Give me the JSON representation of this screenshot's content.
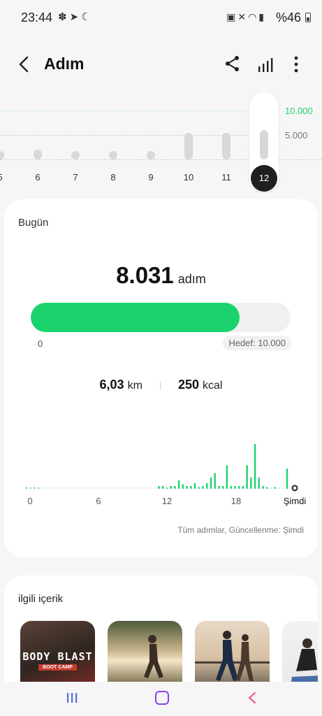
{
  "status_bar": {
    "time": "23:44",
    "battery": "%46",
    "left_icons": [
      "notification-icon",
      "telegram-icon",
      "moon-icon"
    ],
    "right_icons": [
      "sim-icon",
      "mute-icon",
      "wifi-icon",
      "signal-icon"
    ]
  },
  "header": {
    "title": "Adım",
    "icons": [
      "back-icon",
      "share-icon",
      "bar-chart-icon",
      "more-icon"
    ]
  },
  "week_chart": {
    "goal_label": "10.000",
    "mid_label": "5.000",
    "days": [
      "5",
      "6",
      "7",
      "8",
      "9",
      "10",
      "11",
      "12"
    ],
    "levels": [
      0.05,
      0.2,
      0.04,
      0.04,
      0.04,
      0.55,
      0.55,
      0.6
    ],
    "selected_day": "12"
  },
  "today": {
    "label": "Bugün",
    "steps": "8.031",
    "steps_unit": "adım",
    "progress_fraction": 0.8031,
    "progress_start": "0",
    "goal_text": "Hedef: 10.000",
    "distance_value": "6,03",
    "distance_unit": "km",
    "calories_value": "250",
    "calories_unit": "kcal",
    "hourly_axis": [
      "0",
      "6",
      "12",
      "18",
      "Şimdi"
    ],
    "hourly_levels": [
      0,
      0,
      0,
      0,
      0,
      0,
      0,
      0,
      0,
      0,
      0,
      0,
      0,
      0,
      0,
      0,
      0,
      0,
      0,
      0,
      0,
      0,
      0,
      0,
      0,
      0,
      0,
      0,
      0,
      0,
      0,
      0,
      0,
      0.05,
      0.05,
      0.02,
      0.05,
      0.05,
      0.15,
      0.08,
      0.05,
      0.05,
      0.1,
      0.03,
      0.05,
      0.1,
      0.2,
      0.28,
      0.05,
      0.05,
      0.42,
      0.05,
      0.05,
      0.05,
      0.05,
      0.42,
      0.2,
      0.8,
      0.2,
      0.05,
      0.03,
      0,
      0.03,
      0,
      0,
      0.36
    ],
    "updated_note": "Tüm adımlar, Güncellenme: Şimdi"
  },
  "related": {
    "title": "ilgili içerik",
    "items": [
      {
        "name": "thumb-body-blast",
        "line1": "BODY BLAST",
        "line2": "BOOT CAMP"
      },
      {
        "name": "thumb-runner-sunset"
      },
      {
        "name": "thumb-runners-pier"
      },
      {
        "name": "thumb-woman-exercise"
      }
    ]
  },
  "colors": {
    "accent_green": "#1bd36c",
    "nav_home": "#8e3df2",
    "nav_back": "#e86a8a",
    "nav_recents": "#5a6fd6"
  }
}
